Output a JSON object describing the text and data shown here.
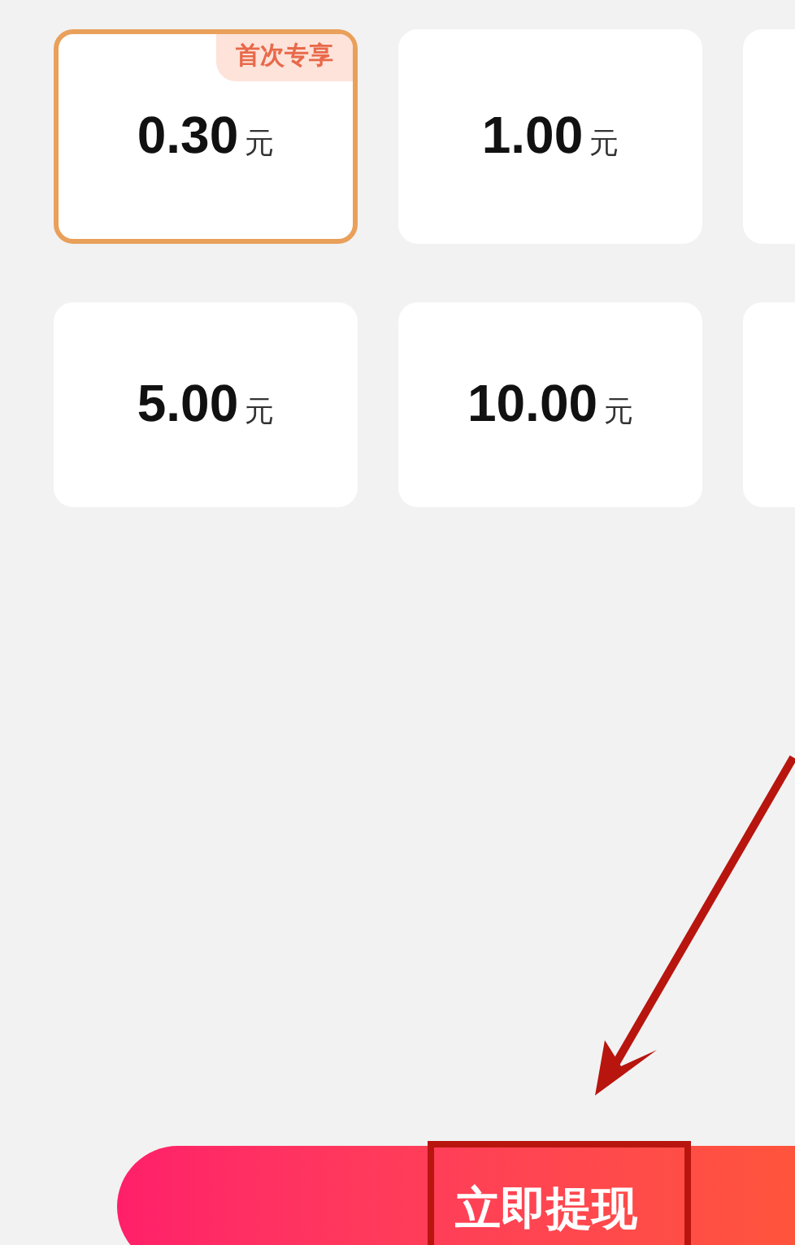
{
  "options": [
    {
      "kind": "amount",
      "amount": "0.30",
      "unit": "元",
      "selected": true,
      "badge": "首次专享"
    },
    {
      "kind": "amount",
      "amount": "1.00",
      "unit": "元",
      "selected": false
    },
    {
      "kind": "partial",
      "selected": false
    },
    {
      "kind": "amount",
      "amount": "5.00",
      "unit": "元",
      "selected": false
    },
    {
      "kind": "amount",
      "amount": "10.00",
      "unit": "元",
      "selected": false
    },
    {
      "kind": "partial",
      "selected": false
    }
  ],
  "withdraw_button": {
    "label": "立即提现"
  }
}
